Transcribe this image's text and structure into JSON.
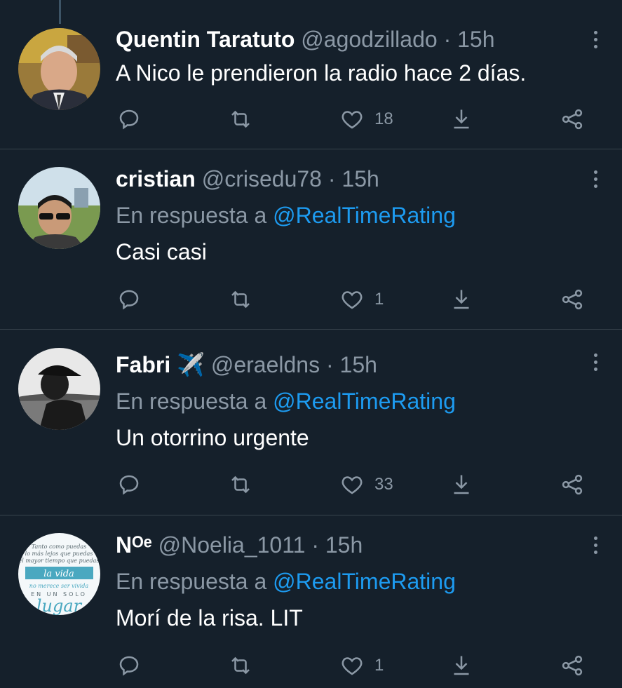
{
  "tweets": [
    {
      "name": "Quentin Taratuto",
      "handle": "@agodzillado",
      "separator": "·",
      "time": "15h",
      "reply_prefix": "",
      "reply_to": "",
      "text": "A Nico le prendieron la radio hace 2 días.",
      "likes": "18"
    },
    {
      "name": "cristian",
      "handle": "@crisedu78",
      "separator": "·",
      "time": "15h",
      "reply_prefix": "En respuesta a",
      "reply_to": "@RealTimeRating",
      "text": "Casi casi",
      "likes": "1"
    },
    {
      "name": "Fabri ✈️",
      "handle": "@eraeldns",
      "separator": "·",
      "time": "15h",
      "reply_prefix": "En respuesta a",
      "reply_to": "@RealTimeRating",
      "text": "Un otorrino urgente",
      "likes": "33"
    },
    {
      "name": "Nᴼᵉ",
      "handle": "@Noelia_1011",
      "separator": "·",
      "time": "15h",
      "reply_prefix": "En respuesta a",
      "reply_to": "@RealTimeRating",
      "text": "Morí de la risa. LIT",
      "likes": "1"
    }
  ],
  "avatar4_text": [
    "Tanto como puedas",
    "lo más lejos que puedas",
    "el mayor tiempo que puedas",
    "la vida",
    "no merece ser vivida",
    "EN UN SOLO",
    "lugar"
  ],
  "colors": {
    "background": "#15202b",
    "accent": "#1d9bf0",
    "secondary_text": "#8b98a5",
    "divider": "#38444d"
  },
  "icons": [
    "reply-icon",
    "retweet-icon",
    "like-icon",
    "download-icon",
    "share-icon",
    "more-icon"
  ]
}
